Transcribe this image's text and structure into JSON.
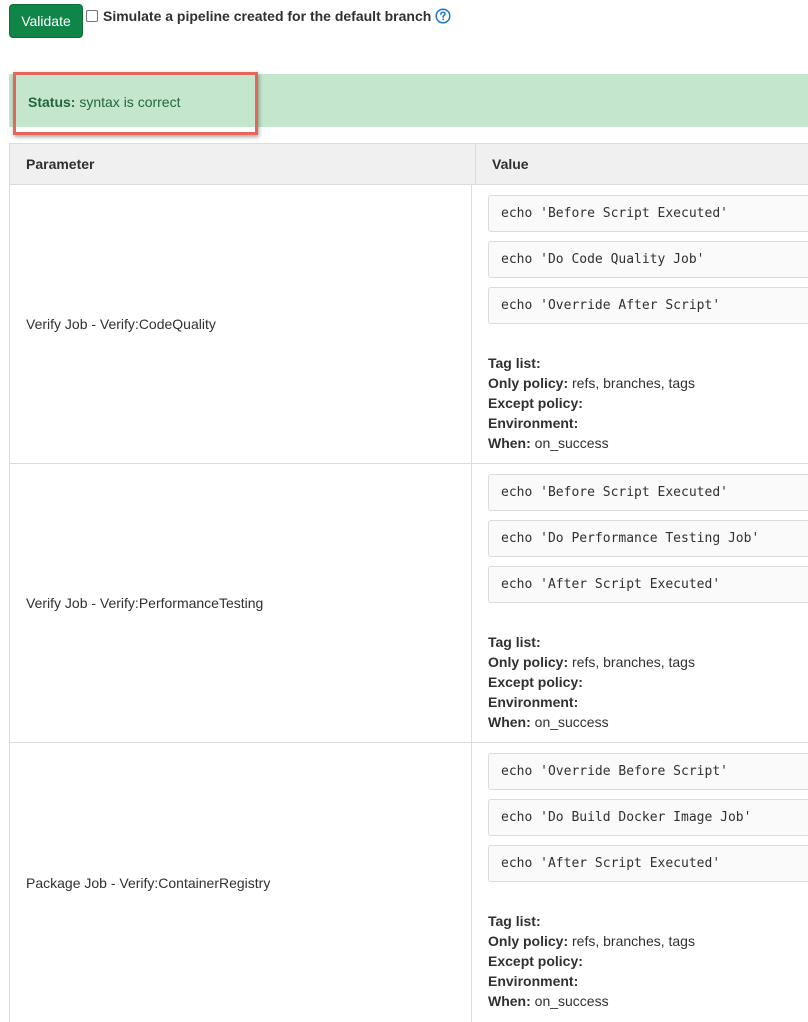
{
  "toolbar": {
    "validate_label": "Validate",
    "simulate_label": "Simulate a pipeline created for the default branch",
    "help_icon": "question-circle-icon"
  },
  "status": {
    "label": "Status:",
    "value": "syntax is correct"
  },
  "table": {
    "headers": {
      "parameter": "Parameter",
      "value": "Value"
    },
    "meta_labels": {
      "tag_list": "Tag list:",
      "only_policy": "Only policy:",
      "except_policy": "Except policy:",
      "environment": "Environment:",
      "when": "When:"
    },
    "rows": [
      {
        "parameter": "Verify Job - Verify:CodeQuality",
        "scripts": [
          "echo 'Before Script Executed'",
          "echo 'Do Code Quality Job'",
          "echo 'Override After Script'"
        ],
        "only_policy": "refs, branches, tags",
        "when": "on_success"
      },
      {
        "parameter": "Verify Job - Verify:PerformanceTesting",
        "scripts": [
          "echo 'Before Script Executed'",
          "echo 'Do Performance Testing Job'",
          "echo 'After Script Executed'"
        ],
        "only_policy": "refs, branches, tags",
        "when": "on_success"
      },
      {
        "parameter": "Package Job - Verify:ContainerRegistry",
        "scripts": [
          "echo 'Override Before Script'",
          "echo 'Do Build Docker Image Job'",
          "echo 'After Script Executed'"
        ],
        "only_policy": "refs, branches, tags",
        "when": "on_success"
      }
    ]
  },
  "colors": {
    "validate_button": "#108548",
    "status_background": "#c3e6cd",
    "status_text": "#24663b",
    "highlight_border": "#e5665a",
    "help_icon": "#1f75cb"
  }
}
